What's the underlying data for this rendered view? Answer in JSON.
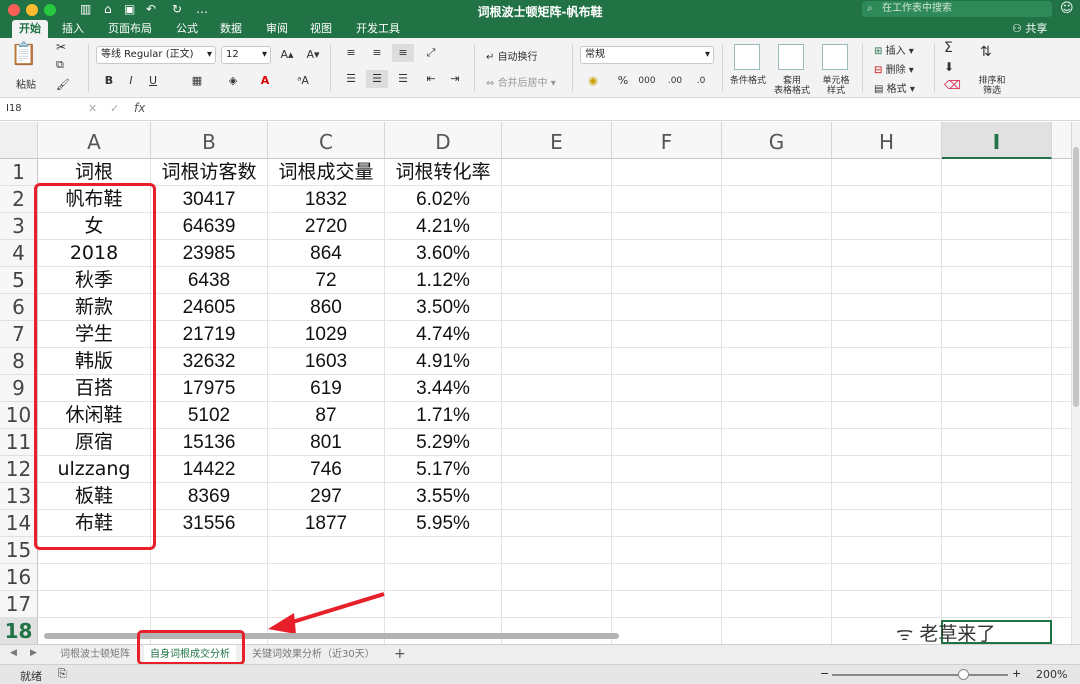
{
  "window": {
    "title": "词根波士顿矩阵-帆布鞋"
  },
  "search": {
    "placeholder": "在工作表中搜索"
  },
  "ribbon_tabs": [
    "开始",
    "插入",
    "页面布局",
    "公式",
    "数据",
    "审阅",
    "视图",
    "开发工具"
  ],
  "share_label": "共享",
  "ribbon": {
    "paste": "粘贴",
    "font_name": "等线 Regular (正文)",
    "font_size": "12",
    "wrap_text": "自动换行",
    "merge_center": "合并后居中",
    "number_format": "常规",
    "conditional_format": "条件格式",
    "format_as_table": "套用\n表格格式",
    "cell_styles": "单元格\n样式",
    "insert": "插入",
    "delete": "删除",
    "format": "格式",
    "sort_filter": "排序和\n筛选",
    "bold": "B",
    "italic": "I",
    "underline": "U",
    "percent": "%",
    "thousands": "000"
  },
  "formula_bar": {
    "name_box": "I18",
    "fx": "fx",
    "content": ""
  },
  "columns": [
    "A",
    "B",
    "C",
    "D",
    "E",
    "F",
    "G",
    "H",
    "I"
  ],
  "selected_column": "I",
  "rows": [
    "1",
    "2",
    "3",
    "4",
    "5",
    "6",
    "7",
    "8",
    "9",
    "10",
    "11",
    "12",
    "13",
    "14",
    "15",
    "16",
    "17",
    "18"
  ],
  "selected_row": "18",
  "table": {
    "headers": [
      "词根",
      "词根访客数",
      "词根成交量",
      "词根转化率"
    ],
    "data": [
      [
        "帆布鞋",
        "30417",
        "1832",
        "6.02%"
      ],
      [
        "女",
        "64639",
        "2720",
        "4.21%"
      ],
      [
        "2018",
        "23985",
        "864",
        "3.60%"
      ],
      [
        "秋季",
        "6438",
        "72",
        "1.12%"
      ],
      [
        "新款",
        "24605",
        "860",
        "3.50%"
      ],
      [
        "学生",
        "21719",
        "1029",
        "4.74%"
      ],
      [
        "韩版",
        "32632",
        "1603",
        "4.91%"
      ],
      [
        "百搭",
        "17975",
        "619",
        "3.44%"
      ],
      [
        "休闲鞋",
        "5102",
        "87",
        "1.71%"
      ],
      [
        "原宿",
        "15136",
        "801",
        "5.29%"
      ],
      [
        "ulzzang",
        "14422",
        "746",
        "5.17%"
      ],
      [
        "板鞋",
        "8369",
        "297",
        "3.55%"
      ],
      [
        "布鞋",
        "31556",
        "1877",
        "5.95%"
      ]
    ]
  },
  "sheets": [
    "词根波士顿矩阵",
    "自身词根成交分析",
    "关键词效果分析（近30天）"
  ],
  "active_sheet_index": 1,
  "watermark": "老草来了",
  "status": {
    "text": "就绪",
    "zoom": "200%"
  },
  "colors": {
    "excel_green": "#217346",
    "annotation_red": "#e8202a"
  }
}
